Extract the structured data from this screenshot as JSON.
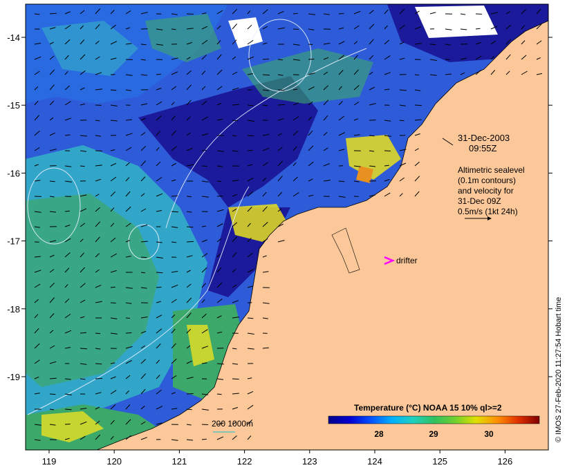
{
  "map": {
    "lon_ticks": [
      "119",
      "120",
      "121",
      "122",
      "123",
      "124",
      "125",
      "126"
    ],
    "lat_ticks": [
      "-14",
      "-15",
      "-16",
      "-17",
      "-18",
      "-19"
    ]
  },
  "annotation": {
    "date": "31-Dec-2003",
    "time": "09:55Z",
    "altimetry_lines": [
      "Altimetric sealevel",
      "(0.1m contours)",
      "and velocity for",
      "31-Dec 09Z",
      "0.5m/s (1kt 24h)"
    ],
    "drifter_label": "drifter",
    "drifter_color": "#ff00ff"
  },
  "isobath_legend": {
    "label": "200  1000m",
    "color": "#40c0c0"
  },
  "colorbar": {
    "title": "Temperature (°C) NOAA 15 10% ql>=2",
    "ticks": [
      "28",
      "29",
      "30"
    ],
    "colors": [
      "#00008b",
      "#0000d0",
      "#0050ff",
      "#00b0ff",
      "#20d0c0",
      "#30c060",
      "#70d030",
      "#e0e000",
      "#ff9000",
      "#e03000",
      "#800000"
    ]
  },
  "credit": "© IMOS 27-Feb-2020 11:27:54 Hobart time",
  "colors": {
    "land": "#fcc89a",
    "ocean_dark": "#1a1a9a",
    "ocean_mid": "#2e5bd8",
    "ocean_cyan": "#32a6c8",
    "ocean_green": "#3ca86a",
    "warm_yellow": "#e8e020",
    "warm_orange": "#e89020"
  }
}
